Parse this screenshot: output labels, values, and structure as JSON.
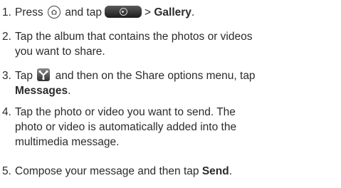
{
  "steps": [
    {
      "number": "1.",
      "press": "Press",
      "and_tap": "and tap",
      "arrow": ">",
      "gallery": "Gallery",
      "end": "."
    },
    {
      "number": "2.",
      "line1": "Tap the album that contains the photos or videos",
      "line2": "you want to share."
    },
    {
      "number": "3.",
      "tap": "Tap",
      "rest": "and then on the Share options menu, tap",
      "messages": "Messages",
      "end": "."
    },
    {
      "number": "4.",
      "line1": "Tap the photo or video you want to send. The",
      "line2": "photo or video is automatically added into the",
      "line3": "multimedia message."
    },
    {
      "number": "5.",
      "text": "Compose your message and then tap",
      "send": "Send",
      "end": "."
    }
  ],
  "icons": {
    "home": "home-icon",
    "app_launcher": "app-launcher-icon",
    "share": "share-icon"
  }
}
